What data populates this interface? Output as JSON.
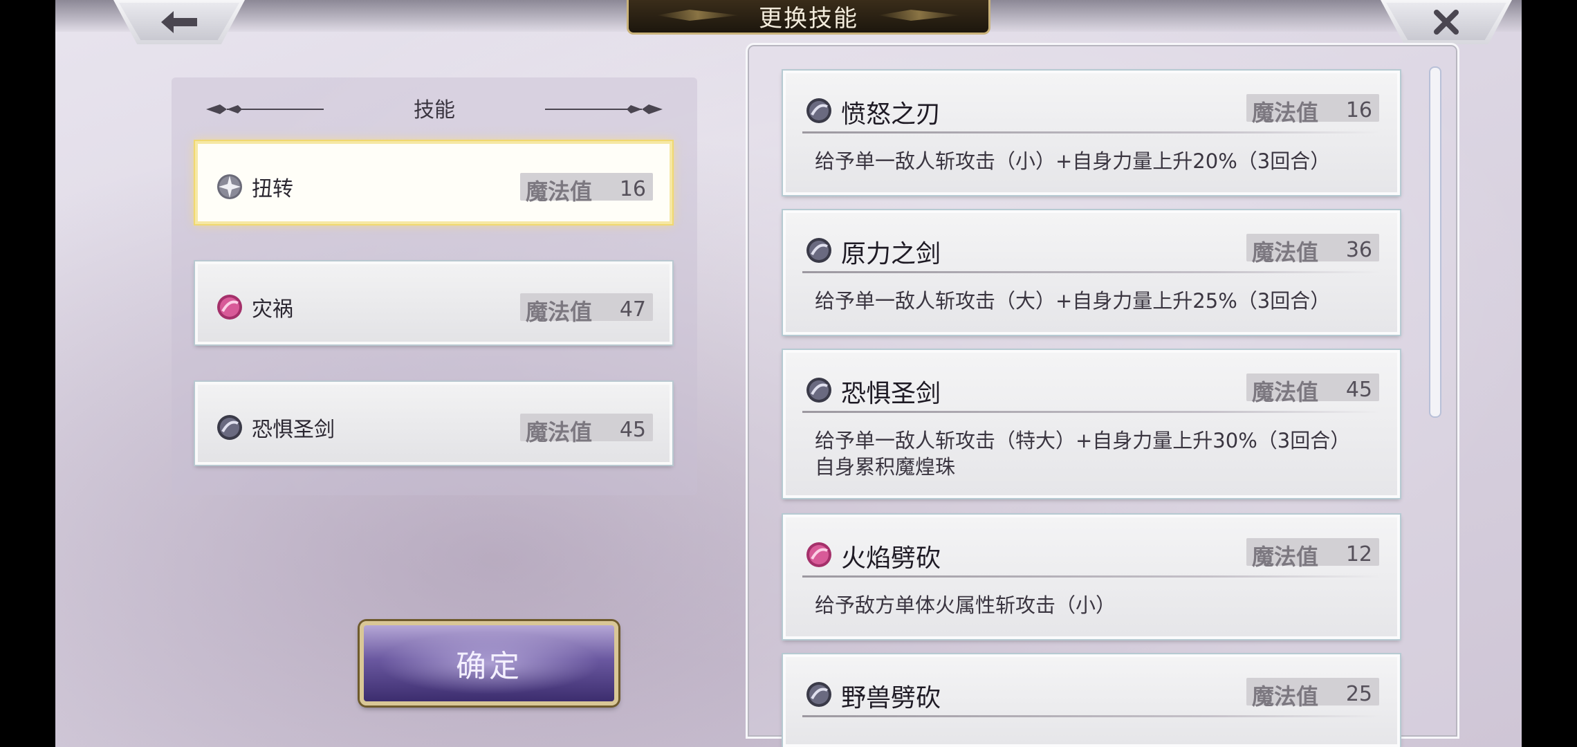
{
  "header": {
    "title": "更换技能"
  },
  "left_panel": {
    "title": "技能",
    "slots": [
      {
        "name": "扭转",
        "mp_label": "魔法值",
        "mp": "16",
        "icon": "star-orb-icon",
        "selected": true
      },
      {
        "name": "灾祸",
        "mp_label": "魔法值",
        "mp": "47",
        "icon": "pink-orb-icon",
        "selected": false
      },
      {
        "name": "恐惧圣剑",
        "mp_label": "魔法值",
        "mp": "45",
        "icon": "dark-orb-icon",
        "selected": false
      }
    ]
  },
  "confirm_label": "确定",
  "skills": [
    {
      "name": "愤怒之刃",
      "mp_label": "魔法值",
      "mp": "16",
      "desc": "给予单一敌人斩攻击（小）+自身力量上升20%（3回合）",
      "icon": "dark-orb-icon"
    },
    {
      "name": "原力之剑",
      "mp_label": "魔法值",
      "mp": "36",
      "desc": "给予单一敌人斩攻击（大）+自身力量上升25%（3回合）",
      "icon": "dark-orb-icon"
    },
    {
      "name": "恐惧圣剑",
      "mp_label": "魔法值",
      "mp": "45",
      "desc": "给予单一敌人斩攻击（特大）+自身力量上升30%（3回合）",
      "desc2": "自身累积魔煌珠",
      "icon": "dark-orb-icon"
    },
    {
      "name": "火焰劈砍",
      "mp_label": "魔法值",
      "mp": "12",
      "desc": "给予敌方单体火属性斩攻击（小）",
      "icon": "pink-orb-icon"
    },
    {
      "name": "野兽劈砍",
      "mp_label": "魔法值",
      "mp": "25",
      "desc": "",
      "icon": "dark-orb-icon"
    }
  ],
  "colors": {
    "selected_glow": "#f0d870",
    "confirm_purple": "#6a58a0",
    "title_gold": "#c9b27a"
  }
}
